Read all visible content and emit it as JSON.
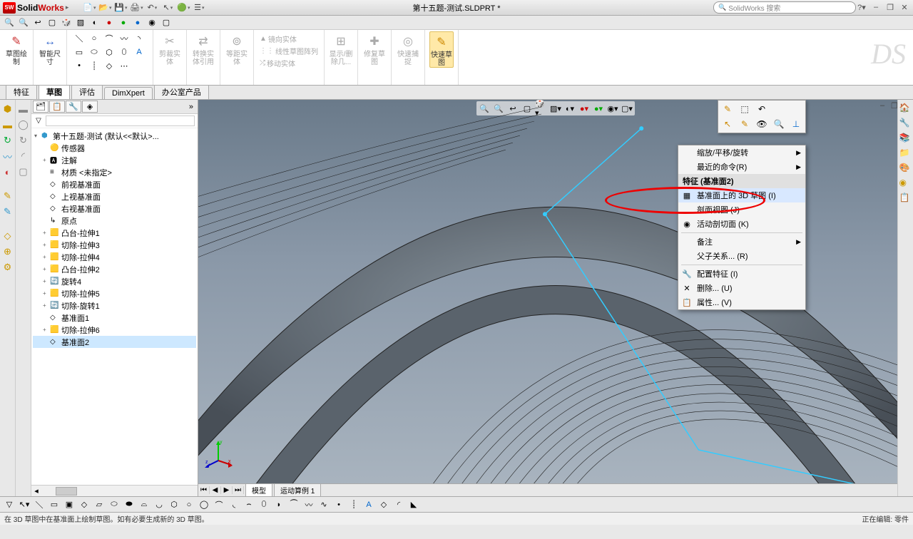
{
  "app": {
    "solid": "Solid",
    "works": "Works"
  },
  "doc_title": "第十五题-测试.SLDPRT *",
  "search_placeholder": "SolidWorks 搜索",
  "ribbon": {
    "sketch_draw": "草图绘\n制",
    "smart_dim": "智能尺\n寸",
    "trim": "剪裁实\n体",
    "convert": "转换实\n体引用",
    "offset": "等距实\n体",
    "mirror": "镜向实体",
    "linear_pattern": "线性草图阵列",
    "move": "移动实体",
    "display_del": "显示/删\n除几...",
    "repair": "修复草\n图",
    "quick_snap": "快速捕\n捉",
    "quick_sketch": "快速草\n图"
  },
  "tabs": [
    "特征",
    "草图",
    "评估",
    "DimXpert",
    "办公室产品"
  ],
  "tree": {
    "root": "第十五题-测试  (默认<<默认>...",
    "items": [
      {
        "icon": "🟡",
        "label": "传感器",
        "l": 1
      },
      {
        "icon": "🅰",
        "label": "注解",
        "exp": "+",
        "l": 1
      },
      {
        "icon": "≡",
        "label": "材质 <未指定>",
        "l": 1
      },
      {
        "icon": "◇",
        "label": "前视基准面",
        "l": 1
      },
      {
        "icon": "◇",
        "label": "上视基准面",
        "l": 1
      },
      {
        "icon": "◇",
        "label": "右视基准面",
        "l": 1
      },
      {
        "icon": "↳",
        "label": "原点",
        "l": 1
      },
      {
        "icon": "🟨",
        "label": "凸台-拉伸1",
        "exp": "+",
        "l": 1
      },
      {
        "icon": "🟨",
        "label": "切除-拉伸3",
        "exp": "+",
        "l": 1
      },
      {
        "icon": "🟨",
        "label": "切除-拉伸4",
        "exp": "+",
        "l": 1
      },
      {
        "icon": "🟨",
        "label": "凸台-拉伸2",
        "exp": "+",
        "l": 1
      },
      {
        "icon": "🔄",
        "label": "旋转4",
        "exp": "+",
        "l": 1
      },
      {
        "icon": "🟨",
        "label": "切除-拉伸5",
        "exp": "+",
        "l": 1
      },
      {
        "icon": "🔄",
        "label": "切除-旋转1",
        "exp": "+",
        "l": 1
      },
      {
        "icon": "◇",
        "label": "基准面1",
        "l": 1
      },
      {
        "icon": "🟨",
        "label": "切除-拉伸6",
        "exp": "+",
        "l": 1
      },
      {
        "icon": "◇",
        "label": "基准面2",
        "l": 1,
        "sel": true
      }
    ]
  },
  "bottom_tabs": [
    "模型",
    "运动算例 1"
  ],
  "context_menu": {
    "header": "特征  (基准面2)",
    "items": [
      {
        "label": "缩放/平移/旋转",
        "arrow": true
      },
      {
        "label": "最近的命令(R)",
        "arrow": true
      },
      {
        "label": "基准面上的 3D 草图 (I)",
        "icon": "▦",
        "hl": true
      },
      {
        "label": "剖面视图  (J)"
      },
      {
        "label": "活动剖切面  (K)",
        "icon": "◉"
      },
      {
        "label": "备注",
        "arrow": true
      },
      {
        "label": "父子关系... (R)"
      },
      {
        "label": "配置特征  (I)",
        "icon": "🔧"
      },
      {
        "label": "删除... (U)",
        "icon": "✕"
      },
      {
        "label": "属性... (V)",
        "icon": "📋"
      }
    ]
  },
  "status_left": "在 3D 草图中在基准面上绘制草图。如有必要生成新的 3D 草图。",
  "status_right": "正在编辑: 零件"
}
